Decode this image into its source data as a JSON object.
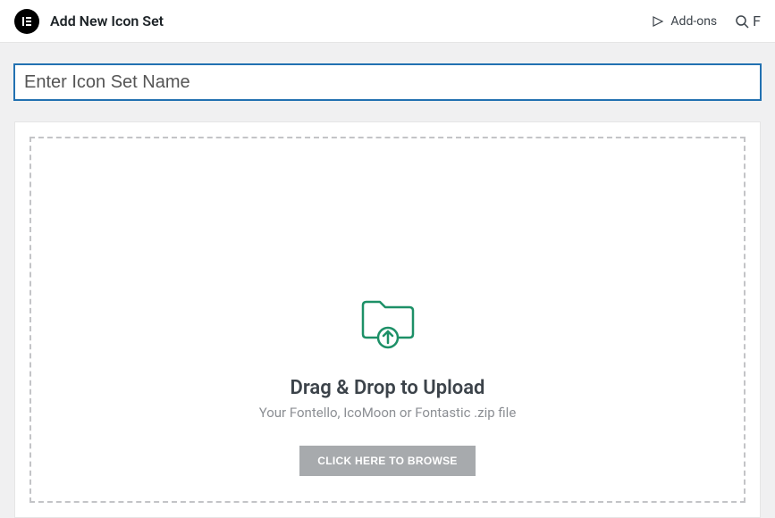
{
  "header": {
    "page_title": "Add New Icon Set",
    "addons_label": "Add-ons",
    "search_label_partial": "F"
  },
  "form": {
    "name_placeholder": "Enter Icon Set Name",
    "name_value": ""
  },
  "dropzone": {
    "title": "Drag & Drop to Upload",
    "subtitle": "Your Fontello, IcoMoon or Fontastic .zip file",
    "browse_button": "CLICK HERE TO BROWSE"
  }
}
